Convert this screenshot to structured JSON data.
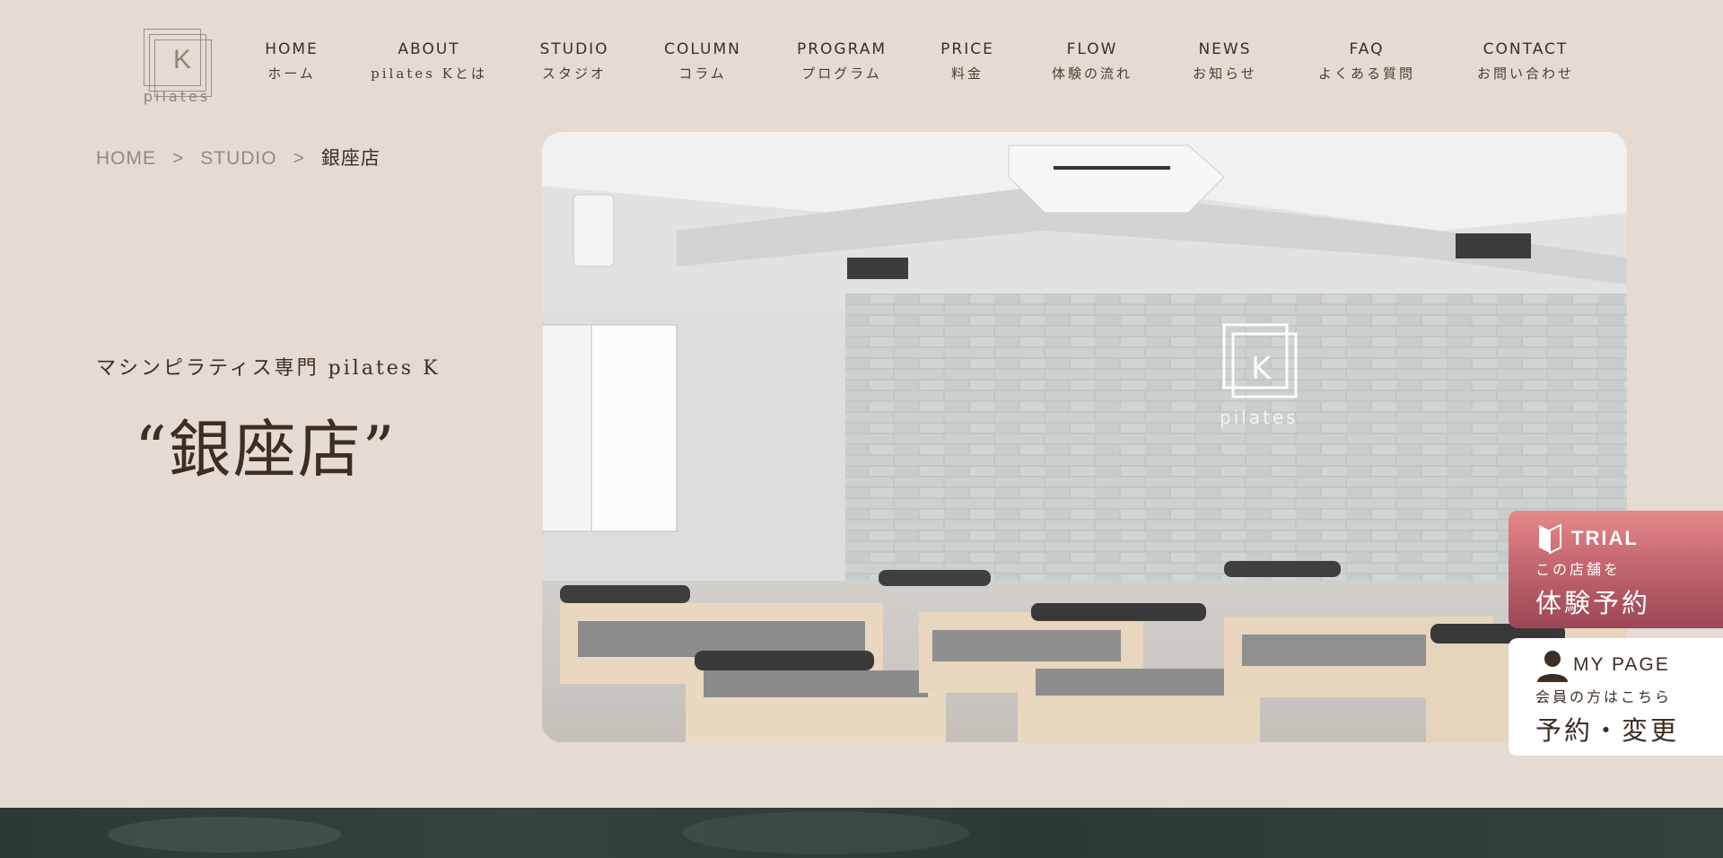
{
  "brand": {
    "logo_letter": "K",
    "logo_word": "pilates"
  },
  "nav": [
    {
      "en": "HOME",
      "ja": "ホーム"
    },
    {
      "en": "ABOUT",
      "ja": "pilates Kとは"
    },
    {
      "en": "STUDIO",
      "ja": "スタジオ"
    },
    {
      "en": "COLUMN",
      "ja": "コラム"
    },
    {
      "en": "PROGRAM",
      "ja": "プログラム"
    },
    {
      "en": "PRICE",
      "ja": "料金"
    },
    {
      "en": "FLOW",
      "ja": "体験の流れ"
    },
    {
      "en": "NEWS",
      "ja": "お知らせ"
    },
    {
      "en": "FAQ",
      "ja": "よくある質問"
    },
    {
      "en": "CONTACT",
      "ja": "お問い合わせ"
    }
  ],
  "breadcrumb": {
    "home": "HOME",
    "separator": ">",
    "studio": "STUDIO",
    "current": "銀座店"
  },
  "hero": {
    "subtitle": "マシンピラティス専門 pilates K",
    "title": "“銀座店”"
  },
  "cta_trial": {
    "en": "TRIAL",
    "small": "この店舗を",
    "big": "体験予約"
  },
  "cta_mypage": {
    "en": "MY PAGE",
    "small": "会員の方はこちら",
    "big": "予約・変更"
  },
  "colors": {
    "background": "#e5dbd3",
    "text": "#3b2f25",
    "trial_top": "#e6898a",
    "trial_bottom": "#9c4656",
    "band": "#2f3e39"
  }
}
